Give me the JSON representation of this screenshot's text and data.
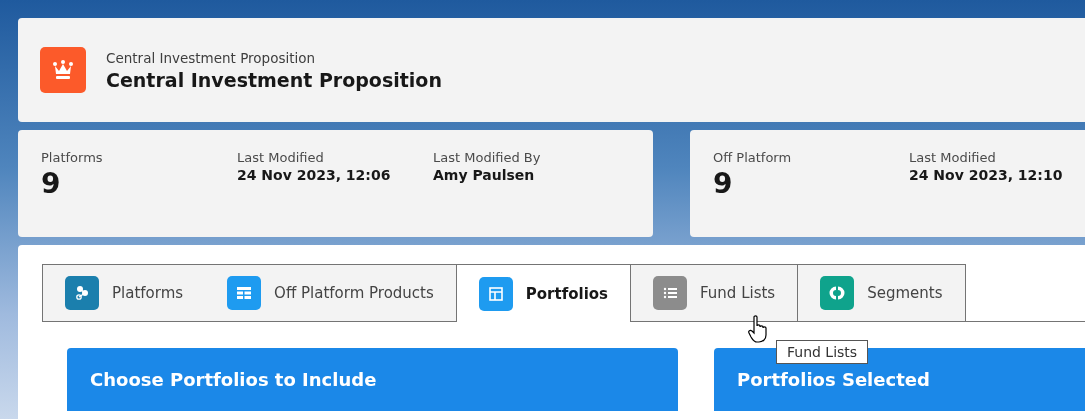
{
  "header": {
    "object_type": "Central Investment Proposition",
    "title": "Central Investment Proposition"
  },
  "stat_cards": [
    {
      "fields": [
        {
          "kind": "big",
          "label": "Platforms",
          "value": "9"
        },
        {
          "kind": "small",
          "label": "Last Modified",
          "value": "24 Nov 2023, 12:06"
        },
        {
          "kind": "small",
          "label": "Last Modified By",
          "value": "Amy Paulsen"
        }
      ]
    },
    {
      "fields": [
        {
          "kind": "big",
          "label": "Off Platform",
          "value": "9"
        },
        {
          "kind": "small",
          "label": "Last Modified",
          "value": "24 Nov 2023, 12:10"
        }
      ]
    }
  ],
  "tabs": [
    {
      "label": "Platforms",
      "kind": "platforms",
      "color": "#1b7fad",
      "selected": false
    },
    {
      "label": "Off Platform Products",
      "kind": "table",
      "color": "#1e9bf0",
      "selected": false
    },
    {
      "label": "Portfolios",
      "kind": "layout",
      "color": "#1e9bf0",
      "selected": true
    },
    {
      "label": "Fund Lists",
      "kind": "list",
      "color": "#8c8c8c",
      "selected": false
    },
    {
      "label": "Segments",
      "kind": "segments",
      "color": "#0fa38c",
      "selected": false
    }
  ],
  "panels": [
    {
      "title": "Choose Portfolios to Include"
    },
    {
      "title": "Portfolios Selected"
    }
  ],
  "tooltip": {
    "text": "Fund Lists"
  }
}
